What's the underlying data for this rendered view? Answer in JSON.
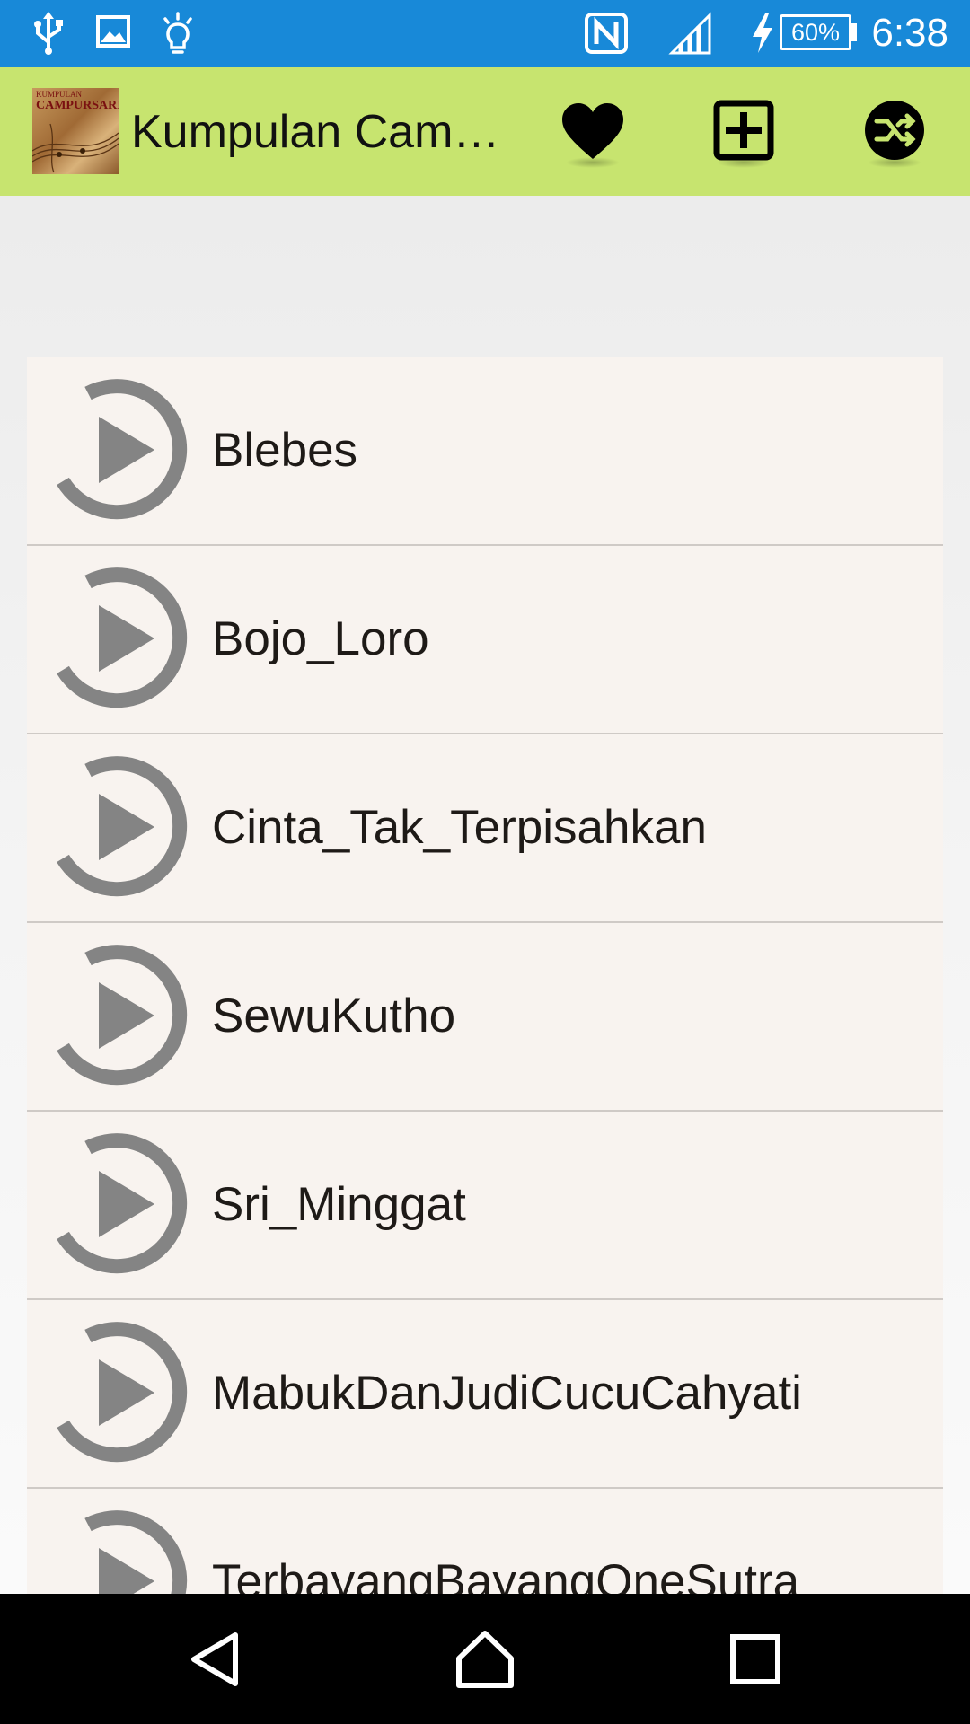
{
  "status_bar": {
    "time": "6:38",
    "battery": "60%",
    "icons": [
      "usb-icon",
      "image-icon",
      "lightbulb-icon",
      "nfc-icon",
      "signal-icon",
      "charging-icon",
      "battery-icon"
    ],
    "background": "#1889d8"
  },
  "app_bar": {
    "title": "Kumpulan Campursari",
    "logo_text_top": "KUMPULAN",
    "logo_text_main": "CAMPURSARI",
    "actions": [
      "heart-icon",
      "add-box-icon",
      "shuffle-icon"
    ],
    "background": "#c7e46f"
  },
  "songs": [
    {
      "title": "Blebes"
    },
    {
      "title": "Bojo_Loro"
    },
    {
      "title": "Cinta_Tak_Terpisahkan"
    },
    {
      "title": "SewuKutho"
    },
    {
      "title": "Sri_Minggat"
    },
    {
      "title": "MabukDanJudiCucuCahyati"
    },
    {
      "title": "TerbayangBayangOneSutra"
    }
  ],
  "nav_bar": {
    "buttons": [
      "back-icon",
      "home-icon",
      "recents-icon"
    ]
  }
}
